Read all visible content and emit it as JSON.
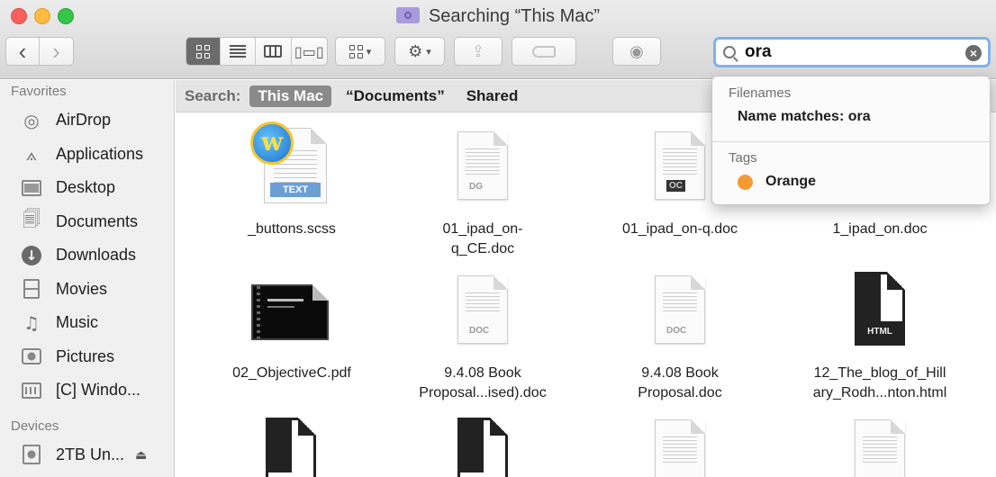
{
  "window": {
    "title": "Searching “This Mac”"
  },
  "toolbar": {
    "back_glyph": "‹",
    "forward_glyph": "›",
    "view_icons": [
      "icon-view-icon",
      "list-view-icon",
      "column-view-icon",
      "cover-flow-icon"
    ],
    "arrange_icon": "arrange-icon",
    "action_icon": "gear-icon",
    "share_icon": "share-icon",
    "tag_icon": "tag-icon",
    "quicklook_icon": "eye-icon"
  },
  "search": {
    "query": "ora",
    "clear_glyph": "×"
  },
  "sidebar": {
    "favorites_heading": "Favorites",
    "favorites": [
      {
        "label": "AirDrop",
        "icon": "airdrop-icon"
      },
      {
        "label": "Applications",
        "icon": "applications-icon"
      },
      {
        "label": "Desktop",
        "icon": "desktop-icon"
      },
      {
        "label": "Documents",
        "icon": "documents-icon"
      },
      {
        "label": "Downloads",
        "icon": "downloads-icon"
      },
      {
        "label": "Movies",
        "icon": "movies-icon"
      },
      {
        "label": "Music",
        "icon": "music-icon"
      },
      {
        "label": "Pictures",
        "icon": "pictures-icon"
      },
      {
        "label": "[C] Windo...",
        "icon": "windows-drive-icon"
      }
    ],
    "devices_heading": "Devices",
    "devices": [
      {
        "label": "2TB Un...",
        "icon": "drive-icon",
        "eject": "⏏"
      }
    ]
  },
  "scope": {
    "label": "Search:",
    "options": [
      "This Mac",
      "“Documents”",
      "Shared"
    ],
    "selected": "This Mac"
  },
  "files": [
    {
      "name": "_buttons.scss",
      "kind": "text"
    },
    {
      "name": "01_ipad_on-q_CE.doc",
      "kind": "doc"
    },
    {
      "name": "01_ipad_on-q.doc",
      "kind": "doc"
    },
    {
      "name": "1_ipad_on.doc",
      "kind": "doc"
    },
    {
      "name": "02_ObjectiveC.pdf",
      "kind": "pdf"
    },
    {
      "name": "9.4.08 Book Proposal...ised).doc",
      "kind": "doc"
    },
    {
      "name": "9.4.08 Book Proposal.doc",
      "kind": "doc"
    },
    {
      "name": "12_The_blog_of_Hillary_Rodh...nton.html",
      "kind": "html"
    }
  ],
  "file_labels": {
    "f1": [
      "_buttons.scss"
    ],
    "f2": [
      "01_ipad_on-",
      "q_CE.doc"
    ],
    "f3": [
      "01_ipad_on-q.doc"
    ],
    "f4": [
      "1_ipad_on.doc"
    ],
    "f5": [
      "02_ObjectiveC.pdf"
    ],
    "f6": [
      "9.4.08 Book",
      "Proposal...ised).doc"
    ],
    "f7": [
      "9.4.08 Book",
      "Proposal.doc"
    ],
    "f8": [
      "12_The_blog_of_Hill",
      "ary_Rodh...nton.html"
    ]
  },
  "thumb_badges": {
    "text": "TEXT",
    "doc": "DOC",
    "html": "HTML",
    "dg": "DG",
    "oc": "OC"
  },
  "dropdown": {
    "filenames_heading": "Filenames",
    "filename_item": "Name matches: ora",
    "tags_heading": "Tags",
    "tag_item": "Orange",
    "tag_color": "#f59a32"
  },
  "colors": {
    "accent": "#7fb2ee",
    "scope_selected_bg": "#8a8a8a"
  }
}
